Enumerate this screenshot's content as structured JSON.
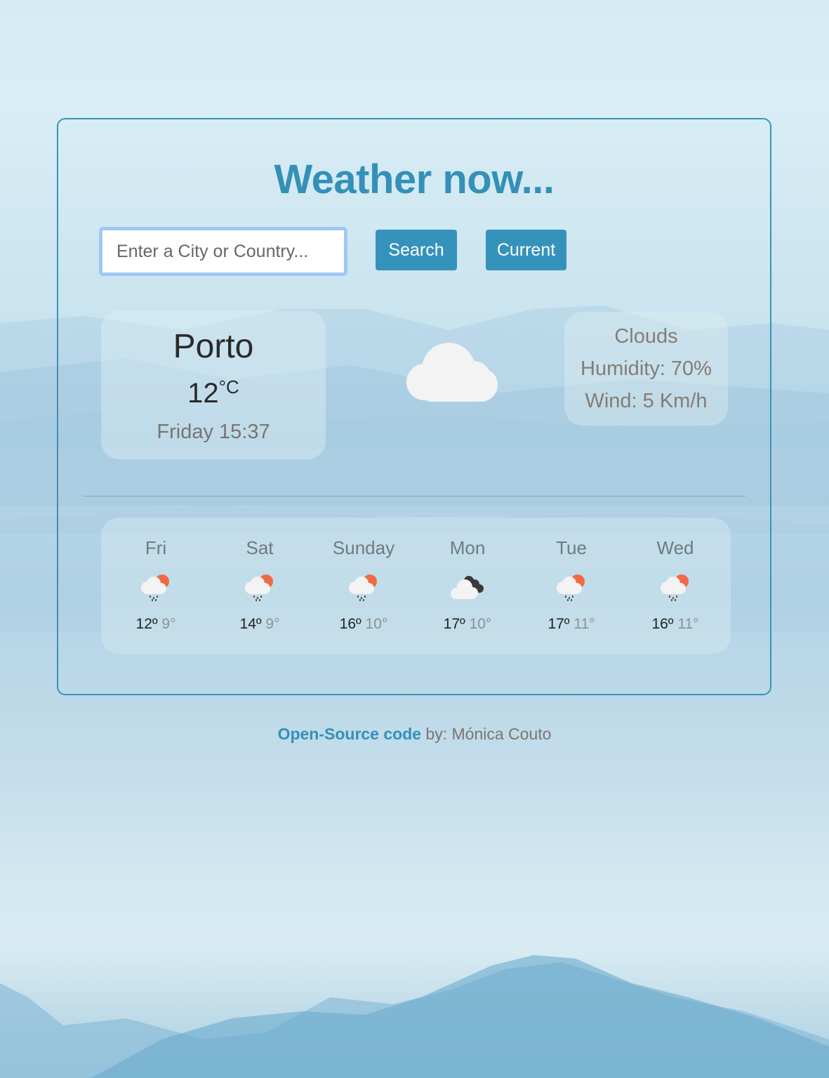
{
  "title": "Weather now...",
  "search": {
    "placeholder": "Enter a City or Country...",
    "value": "",
    "search_label": "Search",
    "current_label": "Current"
  },
  "current": {
    "city": "Porto",
    "temperature": "12",
    "unit": "°C",
    "datetime": "Friday 15:37",
    "icon": "cloud-icon",
    "description": "Clouds",
    "humidity": "Humidity: 70%",
    "wind": "Wind: 5 Km/h"
  },
  "forecast": [
    {
      "day": "Fri",
      "icon": "rain-sun-icon",
      "max": "12º",
      "min": "9°"
    },
    {
      "day": "Sat",
      "icon": "rain-sun-icon",
      "max": "14º",
      "min": "9°"
    },
    {
      "day": "Sunday",
      "icon": "rain-sun-icon",
      "max": "16º",
      "min": "10°"
    },
    {
      "day": "Mon",
      "icon": "broken-clouds-icon",
      "max": "17º",
      "min": "10°"
    },
    {
      "day": "Tue",
      "icon": "rain-sun-icon",
      "max": "17º",
      "min": "11°"
    },
    {
      "day": "Wed",
      "icon": "rain-sun-icon",
      "max": "16º",
      "min": "11°"
    }
  ],
  "footer": {
    "link_text": "Open-Source code",
    "by_text": " by: Mónica Couto"
  },
  "colors": {
    "accent": "#3593bb",
    "title": "#3490b8",
    "sun": "#f06a45",
    "dark_cloud": "#3a3a3a"
  }
}
